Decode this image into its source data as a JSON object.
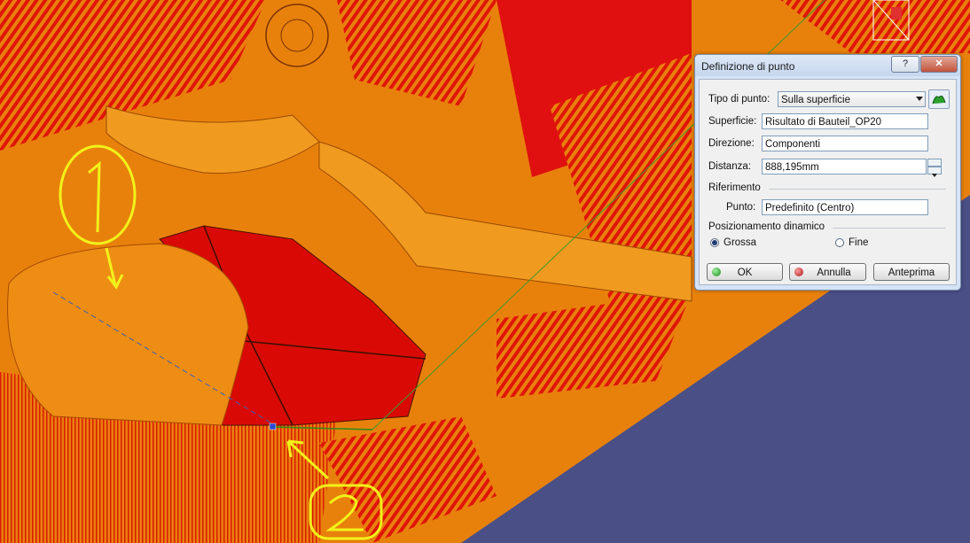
{
  "dialog": {
    "title": "Definizione di punto",
    "help_label": "?",
    "close_label": "✕",
    "type": {
      "label": "Tipo di punto:",
      "value": "Sulla superficie"
    },
    "surface": {
      "label": "Superficie:",
      "value": "Risultato di Bauteil_OP20"
    },
    "direction": {
      "label": "Direzione:",
      "value": "Componenti"
    },
    "distance": {
      "label": "Distanza:",
      "value": "888,195mm"
    },
    "reference": {
      "heading": "Riferimento",
      "point_label": "Punto:",
      "point_value": "Predefinito (Centro)"
    },
    "positioning": {
      "heading": "Posizionamento dinamico",
      "coarse": "Grossa",
      "fine": "Fine",
      "selected": "coarse"
    },
    "buttons": {
      "ok": "OK",
      "cancel": "Annulla",
      "preview": "Anteprima"
    }
  },
  "annotations": {
    "marker_1": "1",
    "marker_2": "2"
  },
  "colors": {
    "model_orange": "#e8810c",
    "model_red": "#e00c08",
    "background": "#4a4f86",
    "annotation_yellow": "#f2f21a"
  }
}
